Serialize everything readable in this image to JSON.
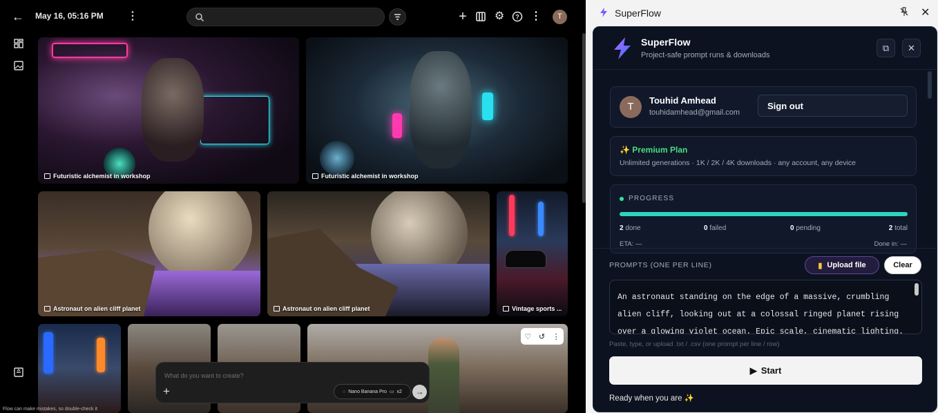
{
  "app": {
    "date": "May 16, 05:16 PM",
    "search_placeholder": "",
    "avatar_letter": "T",
    "tiles": [
      {
        "caption": "Futuristic alchemist in workshop"
      },
      {
        "caption": "Futuristic alchemist in workshop"
      },
      {
        "caption": "Astronaut on alien cliff planet"
      },
      {
        "caption": "Astronaut on alien cliff planet"
      },
      {
        "caption": "Vintage sports ..."
      }
    ],
    "prompt_placeholder": "What do you want to create?",
    "model_chip": "Nano Banana Pro",
    "model_count": "x2",
    "disclaimer": "Flow can make mistakes, so double-check it"
  },
  "panel": {
    "window_title": "SuperFlow",
    "title": "SuperFlow",
    "subtitle": "Project-safe prompt runs & downloads",
    "account": {
      "avatar_letter": "T",
      "name": "Touhid Amhead",
      "email": "touhidamhead@gmail.com",
      "sign_out": "Sign out"
    },
    "plan": {
      "name": "Premium Plan",
      "description": "Unlimited generations · 1K / 2K / 4K downloads · any account, any device"
    },
    "progress": {
      "label": "PROGRESS",
      "fraction": 1.0,
      "done_count": "2",
      "done_label": "done",
      "failed_count": "0",
      "failed_label": "failed",
      "pending_count": "0",
      "pending_label": "pending",
      "total_count": "2",
      "total_label": "total",
      "eta": "ETA: —",
      "done_in": "Done in: —"
    },
    "prompts": {
      "label": "PROMPTS (ONE PER LINE)",
      "upload": "Upload file",
      "clear": "Clear",
      "text": "An astronaut standing on the edge of a massive, crumbling alien cliff, looking out at a colossal ringed planet rising over a glowing violet ocean. Epic scale, cinematic lighting.",
      "hint": "Paste, type, or upload .txt / .csv (one prompt per line / row)"
    },
    "start": "Start",
    "status": "Ready when you are ✨"
  },
  "colors": {
    "accent_green": "#4ade80",
    "progress_teal": "#2dd4bf",
    "panel_bg": "#0c1220"
  }
}
